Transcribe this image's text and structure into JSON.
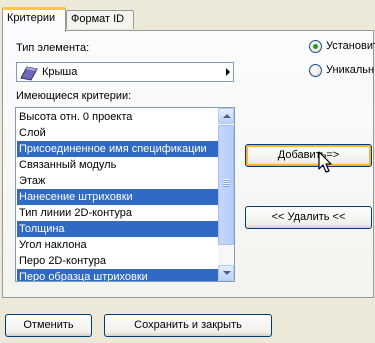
{
  "tabs": [
    {
      "label": "Критерии",
      "active": true
    },
    {
      "label": "Формат ID",
      "active": false
    }
  ],
  "element_type": {
    "label": "Тип элемента:",
    "selected_value": "Крыша",
    "icon": "roof-icon"
  },
  "radios": [
    {
      "label": "Установит",
      "checked": true
    },
    {
      "label": "Уникальн",
      "checked": false
    }
  ],
  "criteria": {
    "label": "Имеющиеся критерии:",
    "items": [
      {
        "text": "Высота отн. 0 проекта",
        "selected": false
      },
      {
        "text": "Слой",
        "selected": false
      },
      {
        "text": "Присоединенное имя спецификации",
        "selected": true
      },
      {
        "text": "Связанный модуль",
        "selected": false
      },
      {
        "text": "Этаж",
        "selected": false
      },
      {
        "text": "Нанесение штриховки",
        "selected": true
      },
      {
        "text": "Тип линии 2D-контура",
        "selected": false
      },
      {
        "text": "Толщина",
        "selected": true
      },
      {
        "text": "Угол наклона",
        "selected": false
      },
      {
        "text": "Перо 2D-контура",
        "selected": false
      },
      {
        "text": "Перо образца штриховки",
        "selected": true
      }
    ]
  },
  "buttons": {
    "add": "Добавить=>",
    "remove": "<< Удалить <<",
    "cancel": "Отменить",
    "save_close": "Сохранить и закрыть"
  },
  "colors": {
    "selection": "#316ac5",
    "dialog_bg": "#ece9d8",
    "hover_border": "#f8b330",
    "radio_dot": "#21a121"
  }
}
